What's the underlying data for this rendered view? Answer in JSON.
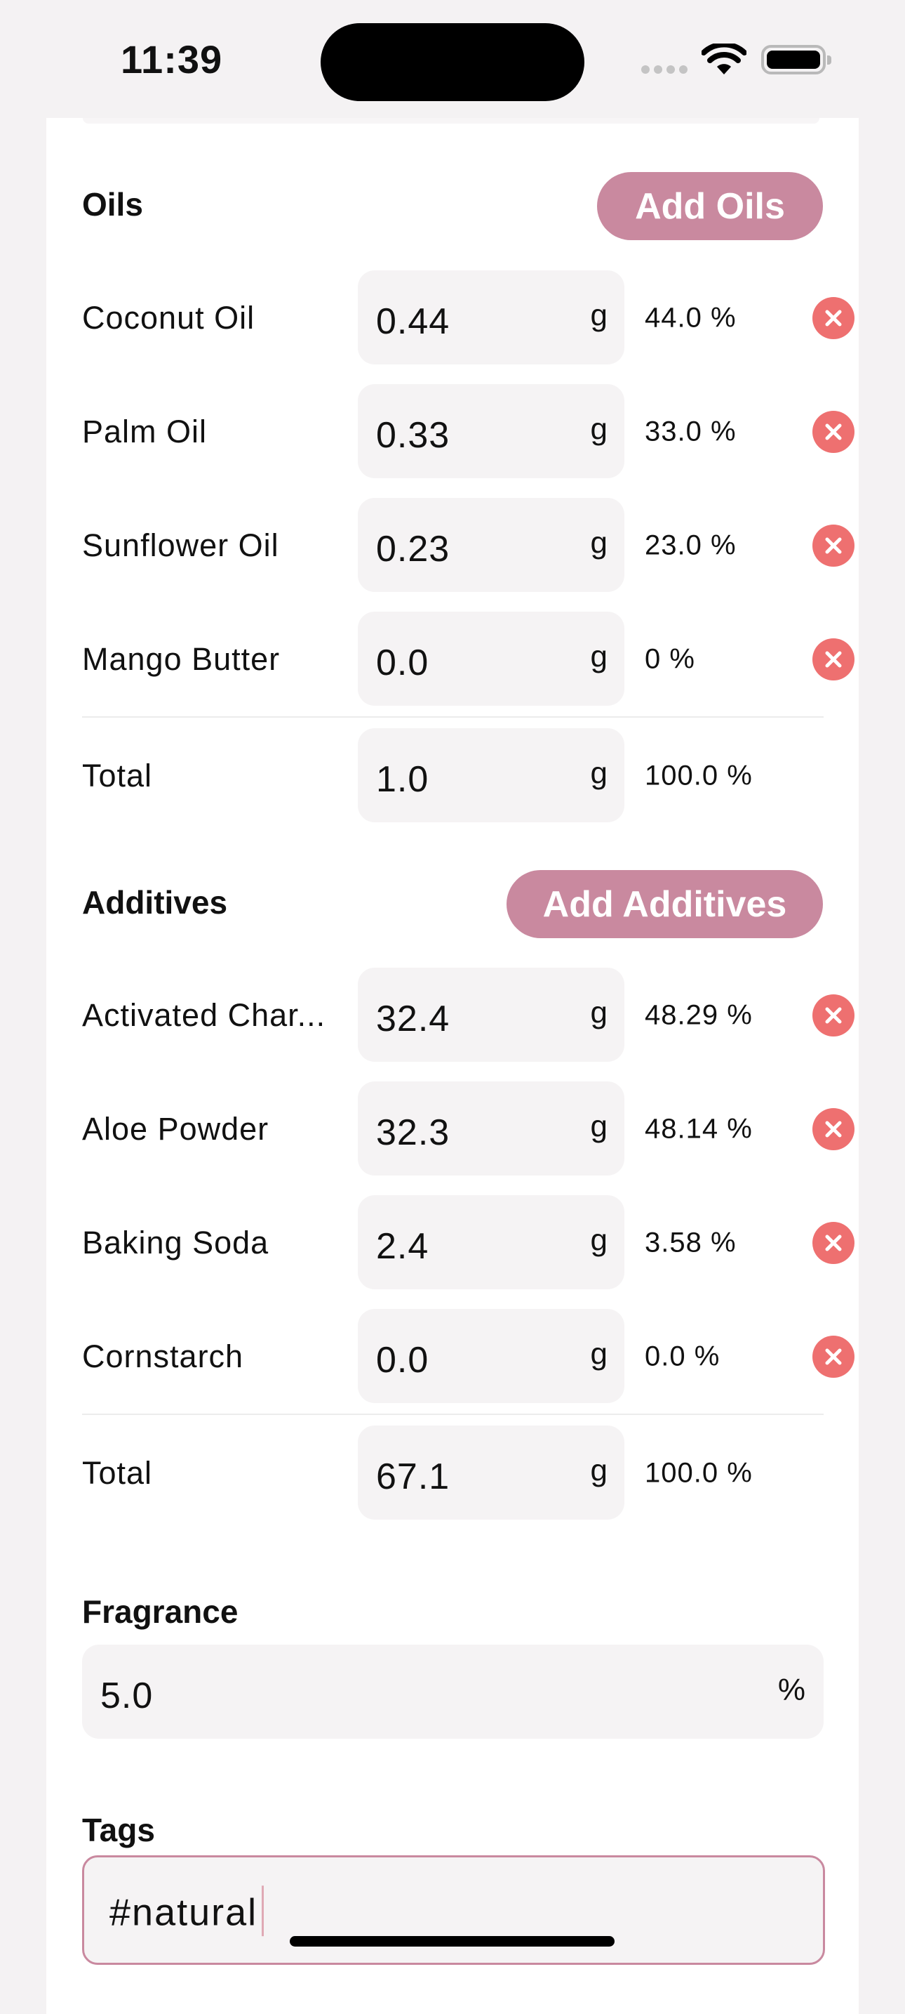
{
  "status_bar": {
    "time": "11:39"
  },
  "oils": {
    "title": "Oils",
    "add_label": "Add Oils",
    "items": [
      {
        "name": "Coconut Oil",
        "value": "0.44",
        "unit": "g",
        "percent": "44.0 %"
      },
      {
        "name": "Palm Oil",
        "value": "0.33",
        "unit": "g",
        "percent": "33.0 %"
      },
      {
        "name": "Sunflower Oil",
        "value": "0.23",
        "unit": "g",
        "percent": "23.0 %"
      },
      {
        "name": "Mango Butter",
        "value": "0.0",
        "unit": "g",
        "percent": "0 %"
      }
    ],
    "total": {
      "label": "Total",
      "value": "1.0",
      "unit": "g",
      "percent": "100.0 %"
    }
  },
  "additives": {
    "title": "Additives",
    "add_label": "Add Additives",
    "items": [
      {
        "name": "Activated Char...",
        "value": "32.4",
        "unit": "g",
        "percent": "48.29 %"
      },
      {
        "name": "Aloe Powder",
        "value": "32.3",
        "unit": "g",
        "percent": "48.14 %"
      },
      {
        "name": "Baking Soda",
        "value": "2.4",
        "unit": "g",
        "percent": "3.58 %"
      },
      {
        "name": "Cornstarch",
        "value": "0.0",
        "unit": "g",
        "percent": "0.0 %"
      }
    ],
    "total": {
      "label": "Total",
      "value": "67.1",
      "unit": "g",
      "percent": "100.0 %"
    }
  },
  "fragrance": {
    "title": "Fragrance",
    "value": "5.0",
    "unit": "%"
  },
  "tags": {
    "title": "Tags",
    "value": "#natural"
  },
  "colors": {
    "accent": "#c9899f",
    "remove": "#ee7070",
    "field_bg": "#f5f3f4"
  }
}
